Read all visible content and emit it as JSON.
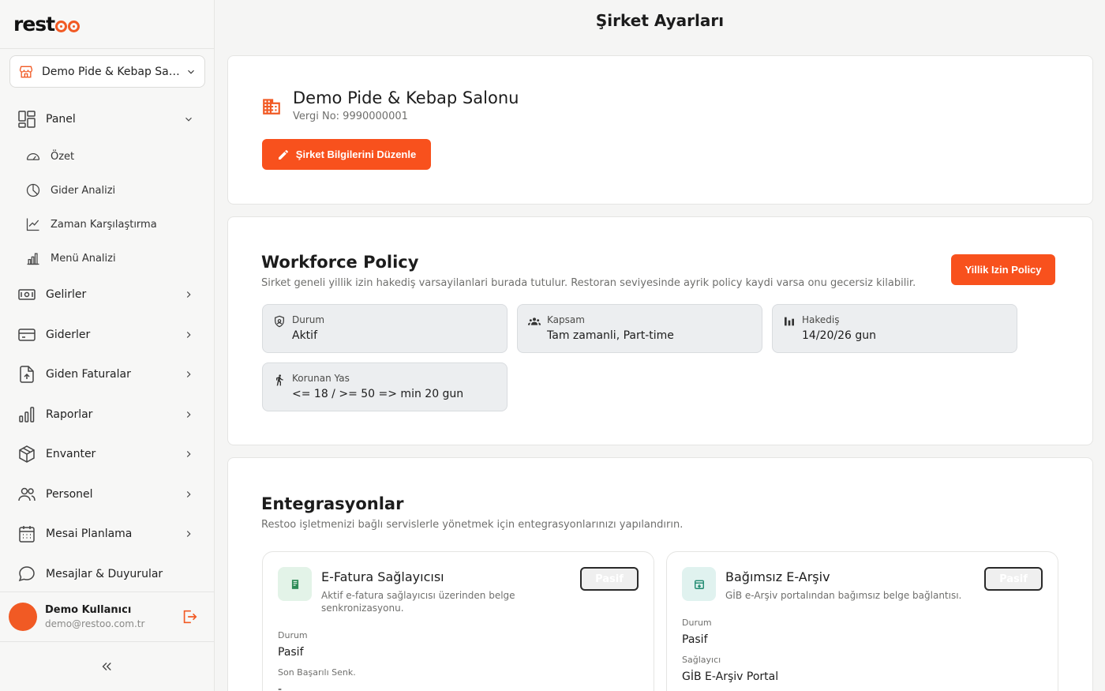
{
  "app": {
    "logo_text": "rest",
    "page_title": "Şirket Ayarları"
  },
  "sidebar": {
    "company_selector": "Demo Pide & Kebap Salonu",
    "items": [
      {
        "label": "Panel",
        "icon": "layout-icon",
        "expanded": true,
        "children": [
          {
            "label": "Özet",
            "icon": "gauge-icon"
          },
          {
            "label": "Gider Analizi",
            "icon": "pie-chart-icon"
          },
          {
            "label": "Zaman Karşılaştırma",
            "icon": "line-chart-icon"
          },
          {
            "label": "Menü Analizi",
            "icon": "bar-chart-icon"
          }
        ]
      },
      {
        "label": "Gelirler",
        "icon": "banknote-icon"
      },
      {
        "label": "Giderler",
        "icon": "credit-card-icon"
      },
      {
        "label": "Giden Faturalar",
        "icon": "file-upload-icon"
      },
      {
        "label": "Raporlar",
        "icon": "bar-chart-icon"
      },
      {
        "label": "Envanter",
        "icon": "box-icon"
      },
      {
        "label": "Personel",
        "icon": "users-icon"
      },
      {
        "label": "Mesai Planlama",
        "icon": "calendar-icon"
      },
      {
        "label": "Mesajlar & Duyurular",
        "icon": "message-icon"
      }
    ],
    "user": {
      "name": "Demo Kullanıcı",
      "email": "demo@restoo.com.tr"
    }
  },
  "company": {
    "name": "Demo Pide & Kebap Salonu",
    "tax_no": "Vergi No: 9990000001",
    "edit_button": "Şirket Bilgilerini Düzenle"
  },
  "workforce": {
    "title": "Workforce Policy",
    "description": "Sirket geneli yillik izin hakediş varsayilanlari burada tutulur. Restoran seviyesinde ayrik policy kaydi varsa onu gecersiz kilabilir.",
    "button": "Yillik Izin Policy",
    "stats": [
      {
        "label": "Durum",
        "value": "Aktif",
        "icon": "shield-icon"
      },
      {
        "label": "Kapsam",
        "value": "Tam zamanli, Part-time",
        "icon": "group-icon"
      },
      {
        "label": "Hakediş",
        "value": "14/20/26 gun",
        "icon": "bars-icon"
      },
      {
        "label": "Korunan Yas",
        "value": "<= 18 / >= 50 => min 20 gun",
        "icon": "walking-icon"
      }
    ]
  },
  "integrations": {
    "title": "Entegrasyonlar",
    "description": "Restoo işletmenizi bağlı servislerle yönetmek için entegrasyonlarınızı yapılandırın.",
    "cards": [
      {
        "name": "E-Fatura Sağlayıcısı",
        "subtitle": "Aktif e-fatura sağlayıcısı üzerinden belge senkronizasyonu.",
        "badge": "Pasif",
        "fields": [
          {
            "label": "Durum",
            "value": "Pasif"
          },
          {
            "label": "Son Başarılı Senk.",
            "value": "-"
          }
        ],
        "accent": "#e3f3e8"
      },
      {
        "name": "Bağımsız E-Arşiv",
        "subtitle": "GİB e-Arşiv portalından bağımsız belge bağlantısı.",
        "badge": "Pasif",
        "fields": [
          {
            "label": "Durum",
            "value": "Pasif"
          },
          {
            "label": "Sağlayıcı",
            "value": "GİB E-Arşiv Portal"
          }
        ],
        "accent": "#e0f2ef"
      }
    ]
  },
  "colors": {
    "accent": "#f8511d",
    "brand": "#f15a24"
  }
}
